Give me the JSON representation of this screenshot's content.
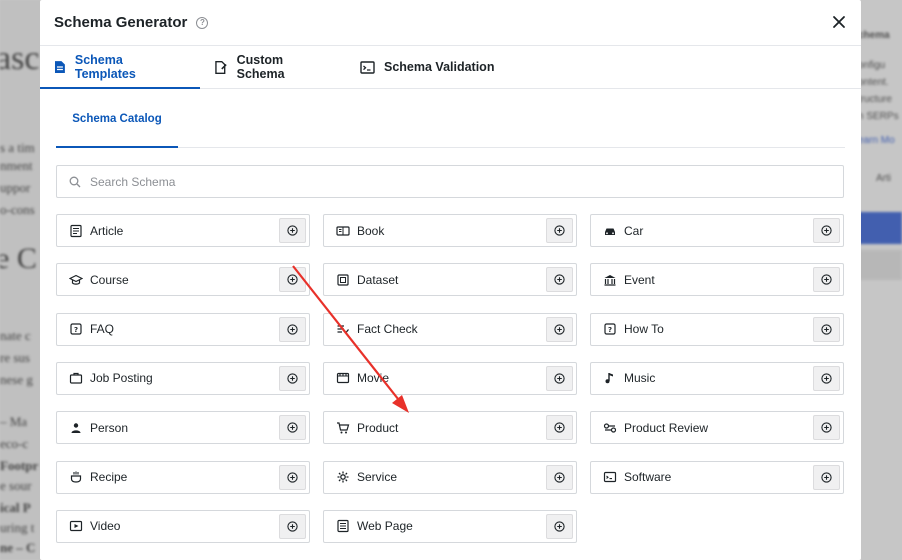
{
  "background": {
    "page_fragments": [
      "asc",
      "s a tim",
      "nment",
      "uppor",
      "o-cons",
      "e C",
      "nate c",
      "re sus",
      "nese g",
      "– Ma",
      "eco-c",
      "Footpr",
      "e sour",
      "ical P",
      "uring t",
      "ne – C"
    ],
    "sidebar_fragments": [
      "chema",
      "onfigu",
      "ontent.",
      "tructure",
      "n SERPs",
      "earn Mo",
      "Arti"
    ]
  },
  "modal": {
    "title": "Schema Generator",
    "close_label": "×",
    "help_label": "?",
    "tabs": [
      {
        "label": "Schema Templates",
        "icon": "document-icon",
        "active": true
      },
      {
        "label": "Custom Schema",
        "icon": "file-edit-icon",
        "active": false
      },
      {
        "label": "Schema Validation",
        "icon": "terminal-icon",
        "active": false
      }
    ],
    "subtab": {
      "label": "Schema Catalog"
    },
    "search": {
      "placeholder": "Search Schema"
    },
    "schemas": [
      {
        "label": "Article",
        "icon": "article-icon"
      },
      {
        "label": "Book",
        "icon": "book-icon"
      },
      {
        "label": "Car",
        "icon": "car-icon"
      },
      {
        "label": "Course",
        "icon": "graduation-cap-icon"
      },
      {
        "label": "Dataset",
        "icon": "dataset-icon"
      },
      {
        "label": "Event",
        "icon": "event-icon"
      },
      {
        "label": "FAQ",
        "icon": "faq-icon"
      },
      {
        "label": "Fact Check",
        "icon": "fact-check-icon"
      },
      {
        "label": "How To",
        "icon": "how-to-icon"
      },
      {
        "label": "Job Posting",
        "icon": "briefcase-icon"
      },
      {
        "label": "Movie",
        "icon": "movie-icon"
      },
      {
        "label": "Music",
        "icon": "music-note-icon"
      },
      {
        "label": "Person",
        "icon": "person-icon"
      },
      {
        "label": "Product",
        "icon": "cart-icon"
      },
      {
        "label": "Product Review",
        "icon": "review-icon"
      },
      {
        "label": "Recipe",
        "icon": "recipe-icon"
      },
      {
        "label": "Service",
        "icon": "service-icon"
      },
      {
        "label": "Software",
        "icon": "software-icon"
      },
      {
        "label": "Video",
        "icon": "video-icon"
      },
      {
        "label": "Web Page",
        "icon": "web-page-icon"
      }
    ]
  },
  "colors": {
    "accent": "#0b57b8",
    "annotation_arrow": "#e8312a",
    "text": "#1d2327",
    "border": "#d5d8dc"
  }
}
